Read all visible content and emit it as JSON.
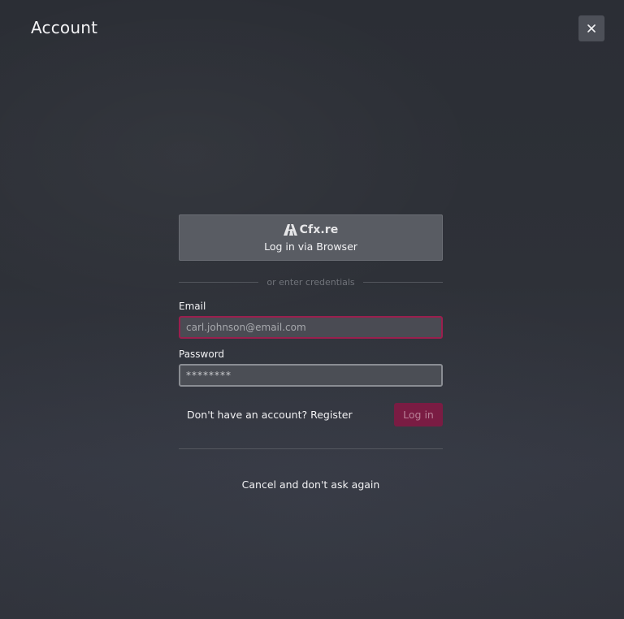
{
  "header": {
    "title": "Account",
    "close_icon": "close-icon"
  },
  "login": {
    "brand_name": "Cfx.re",
    "brand_icon": "cfx-logo",
    "browser_button_label": "Log in via Browser",
    "divider_text": "or enter credentials",
    "email_label": "Email",
    "email_placeholder": "carl.johnson@email.com",
    "email_value": "",
    "password_label": "Password",
    "password_value": "********",
    "register_text": "Don't have an account? Register",
    "login_button_label": "Log in",
    "cancel_text": "Cancel and don't ask again"
  },
  "colors": {
    "accent": "#7a1c43",
    "focus_border": "#9a1f4e",
    "background": "#2e3138"
  }
}
